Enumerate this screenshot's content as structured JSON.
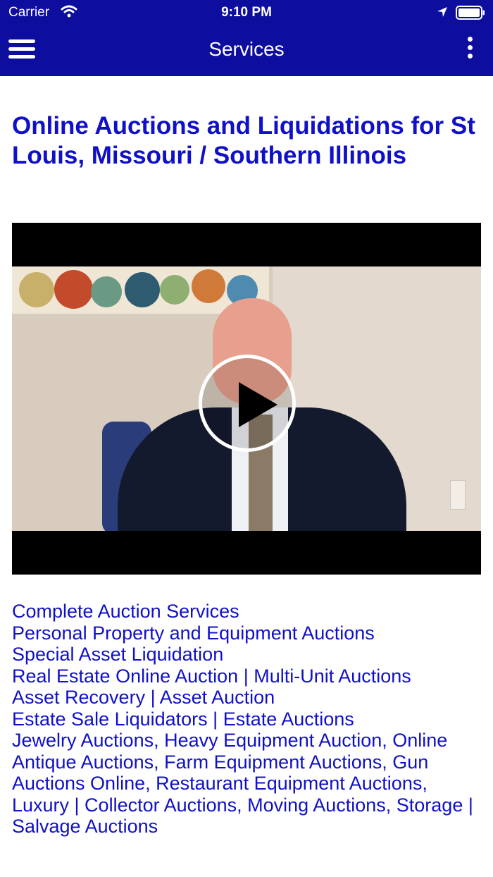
{
  "status_bar": {
    "carrier": "Carrier",
    "time": "9:10 PM"
  },
  "nav": {
    "title": "Services",
    "menu_icon": "hamburger-icon",
    "more_icon": "vertical-dots-icon",
    "color": "#0d0d9e"
  },
  "page": {
    "heading": "Online Auctions and Liquidations for St Louis, Missouri / Southern Illinois",
    "video": {
      "play_icon": "play-icon"
    },
    "links": [
      "Complete Auction Services",
      "Personal Property and Equipment Auctions",
      "Special Asset Liquidation",
      "Real Estate Online Auction | Multi-Unit Auctions",
      "Asset Recovery | Asset Auction",
      "Estate Sale Liquidators | Estate Auctions",
      "Jewelry Auctions, Heavy Equipment Auction, Online Antique Auctions, Farm Equipment Auctions, Gun Auctions Online, Restaurant Equipment Auctions, Luxury | Collector Auctions, Moving Auctions, Storage | Salvage Auctions"
    ],
    "link_color": "#1010c8"
  }
}
